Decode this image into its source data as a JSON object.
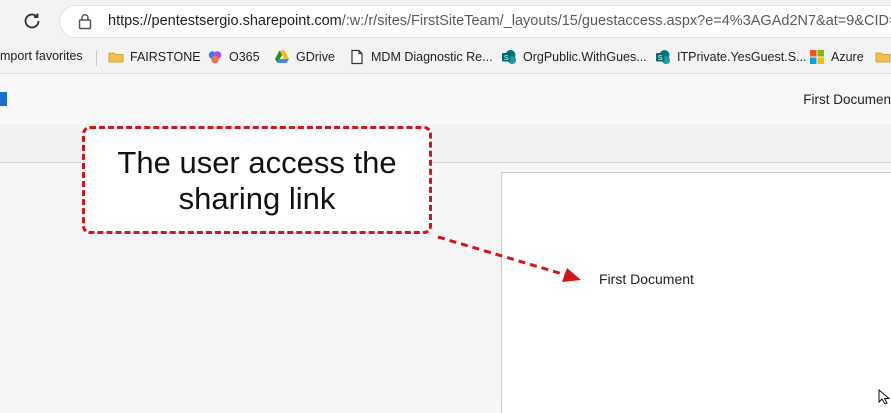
{
  "browser": {
    "url_host": "https://pentestsergio.sharepoint.com",
    "url_path": "/:w:/r/sites/FirstSiteTeam/_layouts/15/guestaccess.aspx?e=4%3AGAd2N7&at=9&CID=74E",
    "reload_icon": "reload-icon",
    "lock_icon": "lock-icon"
  },
  "bookmarks": [
    {
      "label": "mport favorites",
      "icon": "none"
    },
    {
      "label": "FAIRSTONE",
      "icon": "folder-icon"
    },
    {
      "label": "O365",
      "icon": "copilot-icon"
    },
    {
      "label": "GDrive",
      "icon": "gdrive-icon"
    },
    {
      "label": "MDM Diagnostic Re...",
      "icon": "document-icon"
    },
    {
      "label": "OrgPublic.WithGues...",
      "icon": "sharepoint-icon"
    },
    {
      "label": "ITPrivate.YesGuest.S...",
      "icon": "sharepoint-icon"
    },
    {
      "label": "Azure",
      "icon": "microsoft-icon"
    }
  ],
  "app": {
    "doc_title": "First Documen"
  },
  "document": {
    "body_text": "First Document"
  },
  "annotation": {
    "text": "The user access the sharing link",
    "color": "#d0161a"
  }
}
